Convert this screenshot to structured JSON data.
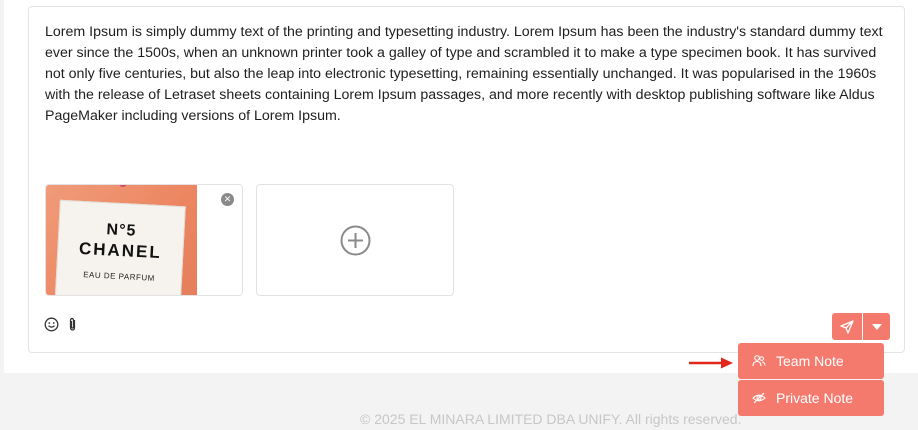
{
  "editor": {
    "body_text": "Lorem Ipsum is simply dummy text of the printing and typesetting industry. Lorem Ipsum has been the industry's standard dummy text ever since the 1500s, when an unknown printer took a galley of type and scrambled it to make a type specimen book. It has survived not only five centuries, but also the leap into electronic typesetting, remaining essentially unchanged. It was popularised in the 1960s with the release of Letraset sheets containing Lorem Ipsum passages, and more recently with desktop publishing software like Aldus PageMaker including versions of Lorem Ipsum."
  },
  "attachments": [
    {
      "label_lines": [
        "N°5",
        "CHANEL",
        "EAU DE PARFUM"
      ],
      "remove_icon": "close-circle-icon"
    },
    {
      "add_icon": "plus-circle-icon"
    }
  ],
  "toolbar": {
    "emoji_icon": "smiley-icon",
    "attach_icon": "paperclip-icon",
    "send_icon": "send-icon",
    "dropdown_icon": "caret-down-icon"
  },
  "menu": {
    "items": [
      {
        "label": "Team Note",
        "icon": "team-icon"
      },
      {
        "label": "Private Note",
        "icon": "eye-off-icon"
      }
    ]
  },
  "annotation": {
    "arrow_icon": "red-arrow-icon",
    "color": "#e3261c"
  },
  "colors": {
    "accent": "#f47a6e"
  },
  "footer": {
    "text": "© 2025 EL MINARA LIMITED DBA UNIFY. All rights reserved."
  }
}
